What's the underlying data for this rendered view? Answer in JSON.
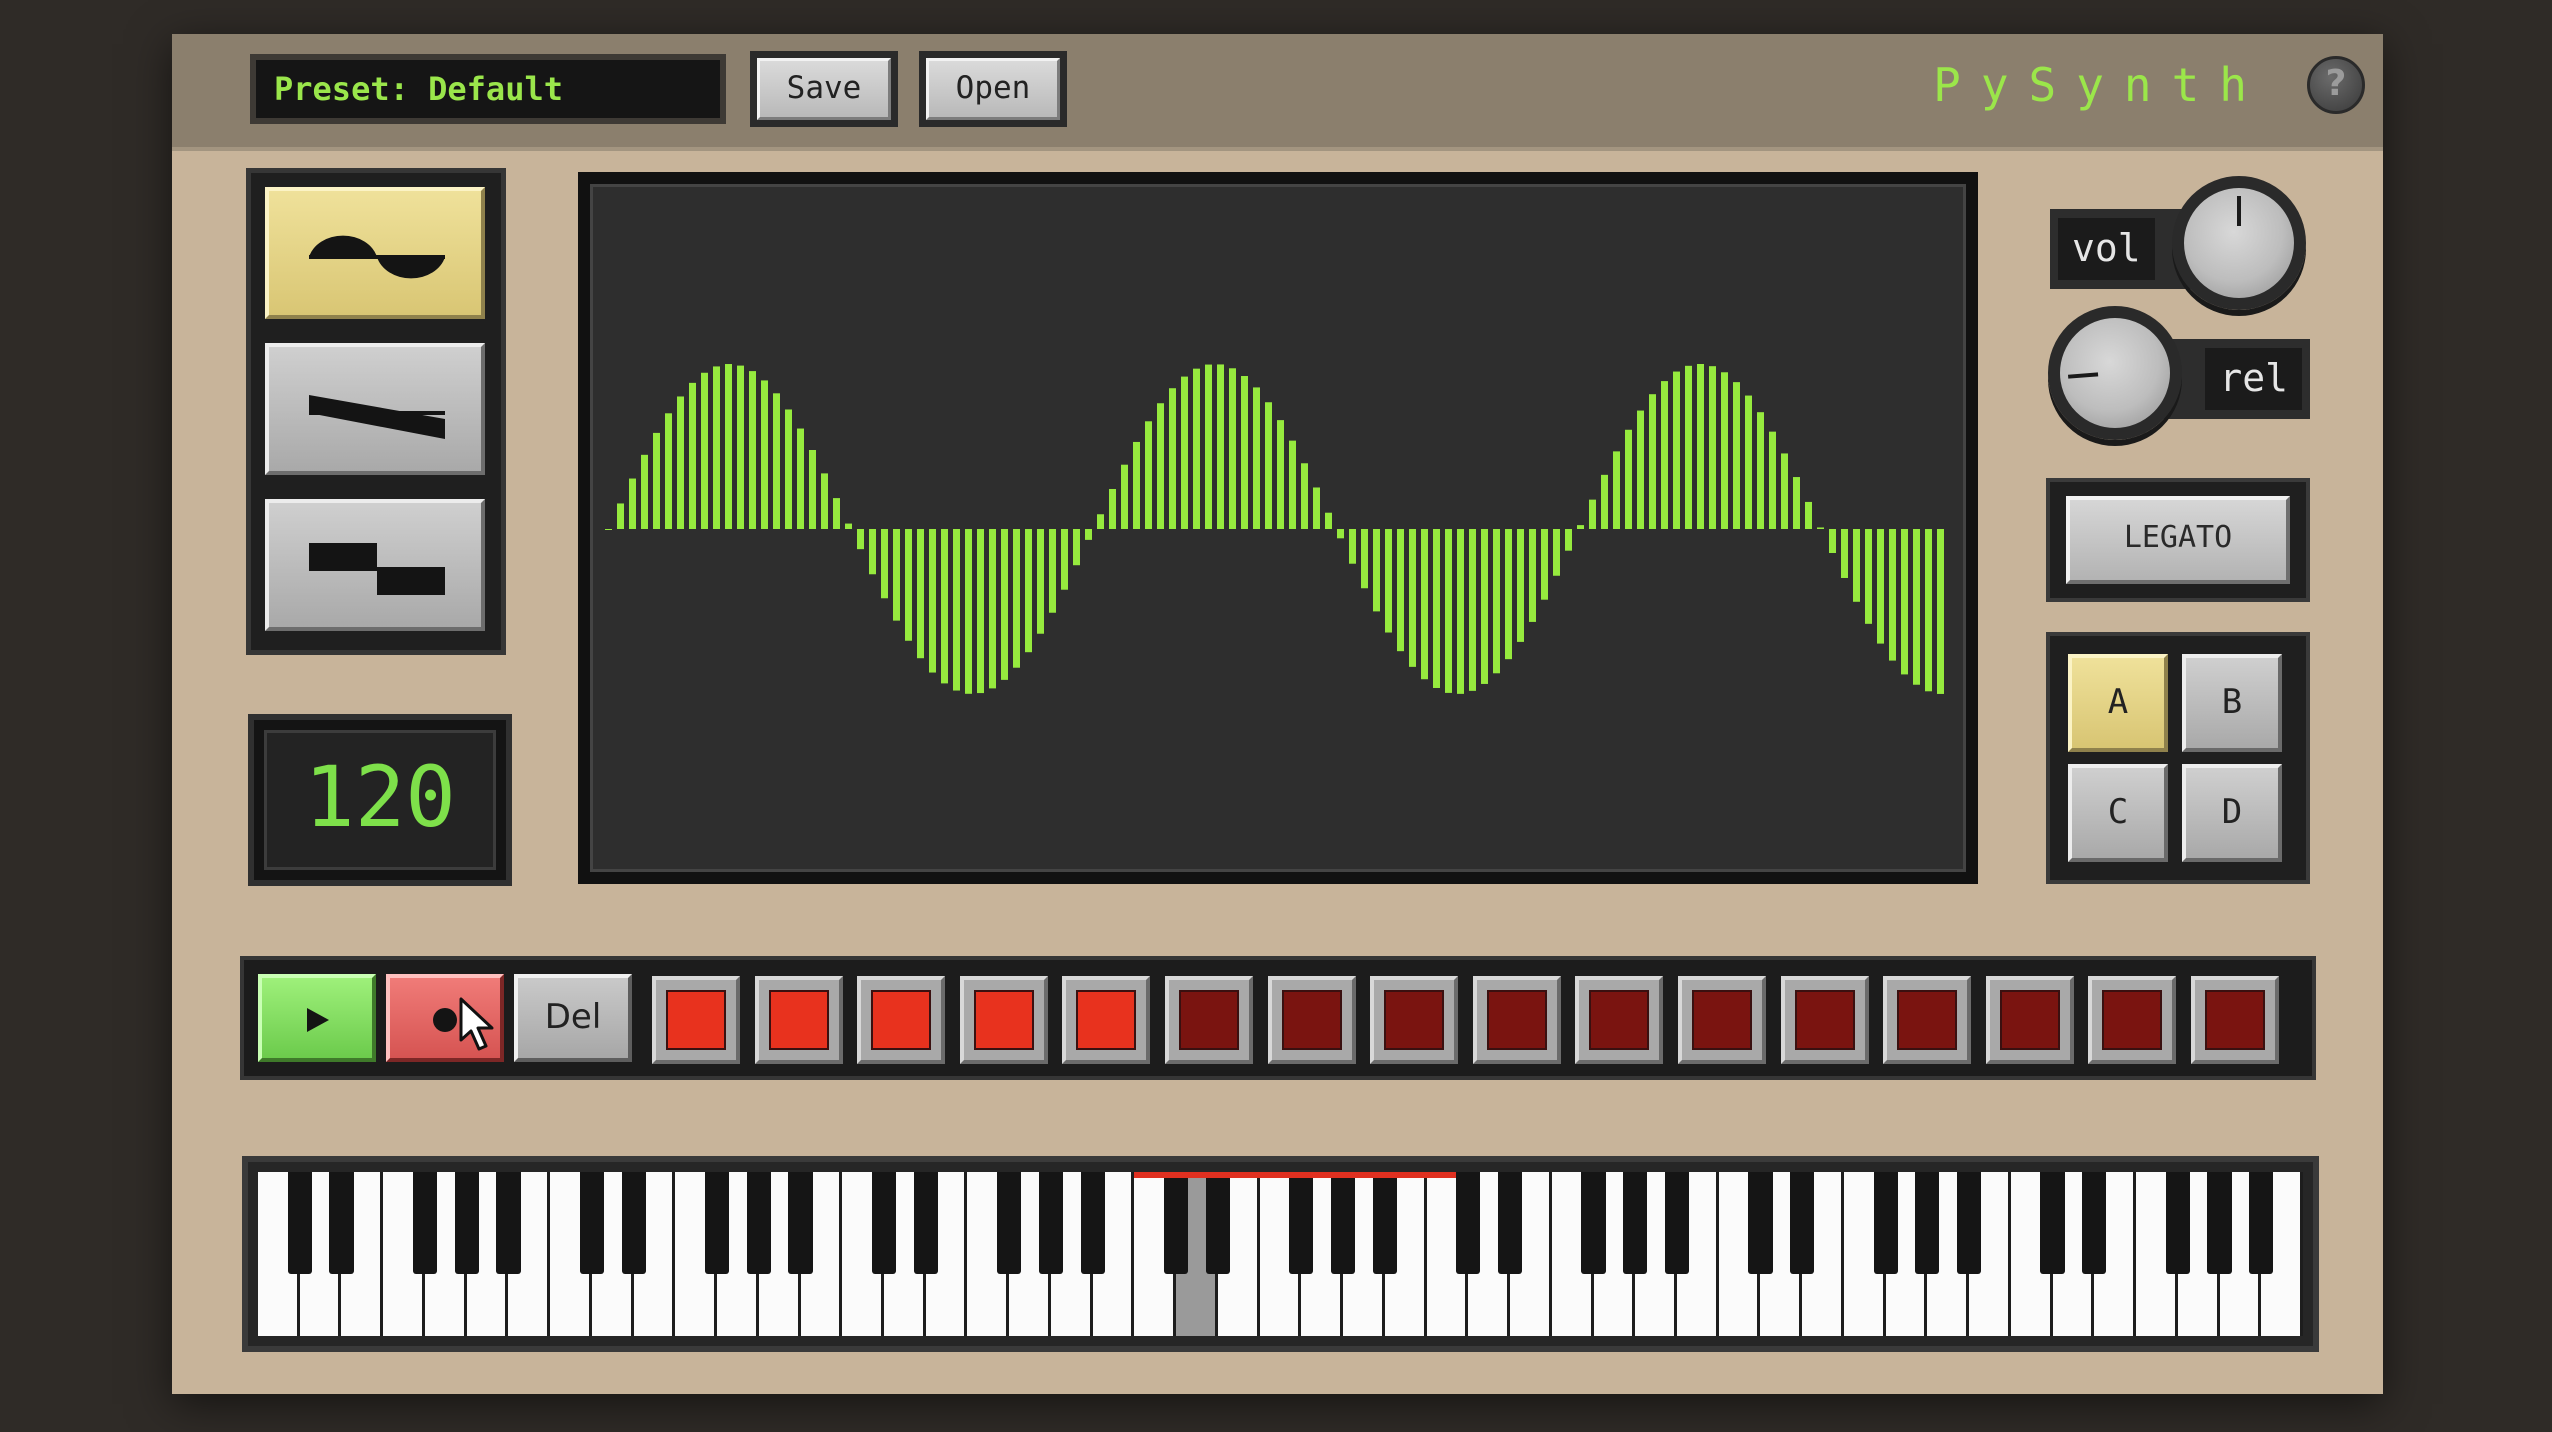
{
  "topbar": {
    "preset_label": "Preset: Default",
    "save_label": "Save",
    "open_label": "Open",
    "brand": "PySynth",
    "help_label": "?"
  },
  "waveforms": {
    "items": [
      "sine",
      "sawtooth",
      "square"
    ],
    "selected": "sine"
  },
  "tempo": {
    "value": "120"
  },
  "oscilloscope": {
    "color": "#96ea3e",
    "wave_type": "sine",
    "visible_cycles": 2.75
  },
  "knobs": {
    "vol": {
      "label": "vol",
      "level": 0.5
    },
    "rel": {
      "label": "rel",
      "level": 0.15
    }
  },
  "legato_label": "LEGATO",
  "banks": {
    "labels": [
      "A",
      "B",
      "C",
      "D"
    ],
    "selected": "A"
  },
  "transport": {
    "play_icon": "play-icon",
    "record_icon": "record-icon",
    "delete_label": "Del"
  },
  "sequencer": {
    "step_count": 16,
    "steps": [
      true,
      true,
      true,
      true,
      true,
      false,
      false,
      false,
      false,
      false,
      false,
      false,
      false,
      false,
      false,
      false
    ],
    "colors": {
      "on": "#e8321e",
      "off": "#7a1410"
    }
  },
  "keyboard": {
    "white_keys": 49,
    "pressed_white_key": 22,
    "highlight_color": "#e03020"
  }
}
